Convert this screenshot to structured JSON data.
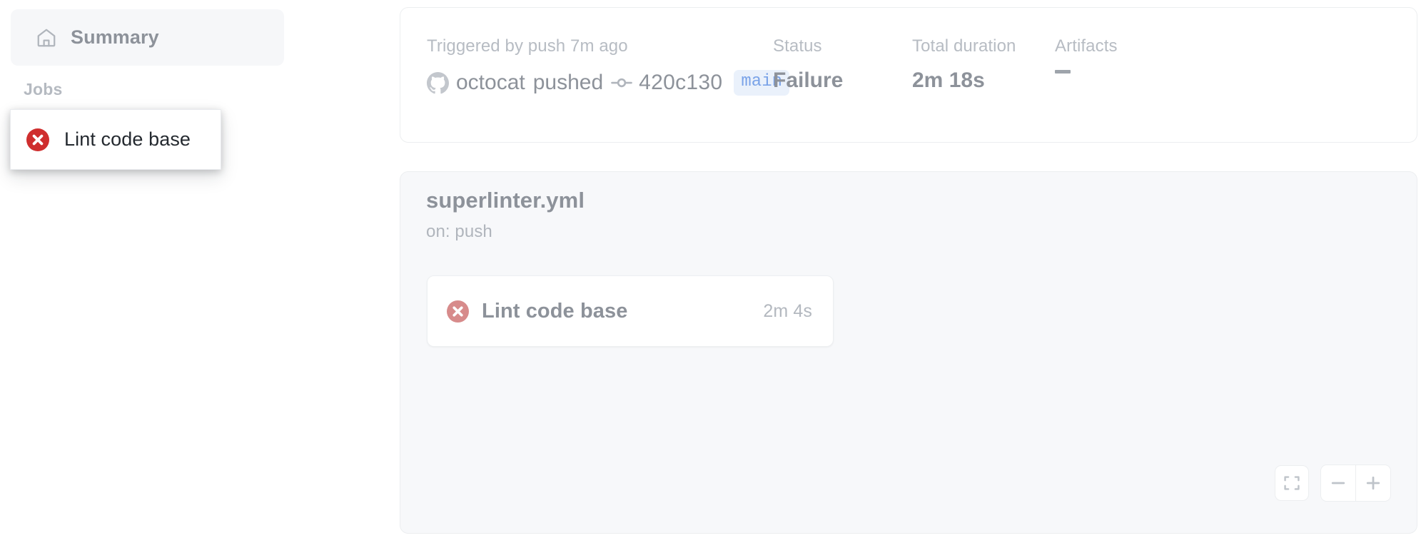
{
  "sidebar": {
    "summary": {
      "label": "Summary",
      "icon": "home-icon"
    },
    "jobs_heading": "Jobs",
    "dragged_job": {
      "label": "Lint code base",
      "status_icon": "failure-x-icon"
    }
  },
  "run_header": {
    "trigger": {
      "label": "Triggered by push 7m ago",
      "actor": "octocat",
      "action": "pushed",
      "commit_sha": "420c130",
      "branch": "main",
      "avatar_icon": "github-mark-icon",
      "commit_icon": "git-commit-icon"
    },
    "status": {
      "label": "Status",
      "value": "Failure"
    },
    "duration": {
      "label": "Total duration",
      "value": "2m 18s"
    },
    "artifacts": {
      "label": "Artifacts",
      "value": "–"
    }
  },
  "workflow_graph": {
    "title": "superlinter.yml",
    "subtitle": "on: push",
    "nodes": [
      {
        "label": "Lint code base",
        "duration": "2m 4s",
        "status_icon": "failure-x-icon"
      }
    ],
    "controls": {
      "fit": "fit-to-screen-icon",
      "zoom_out": "minus-icon",
      "zoom_in": "plus-icon"
    }
  },
  "colors": {
    "failure_red": "#cf2e2e",
    "failure_red_muted": "#d78b8b",
    "branch_badge_text": "#7aa3e8",
    "branch_badge_bg": "#eaf1fb",
    "muted_text": "#8d929a",
    "label_text": "#b7bcc3",
    "graph_bg": "#f7f8fa"
  }
}
